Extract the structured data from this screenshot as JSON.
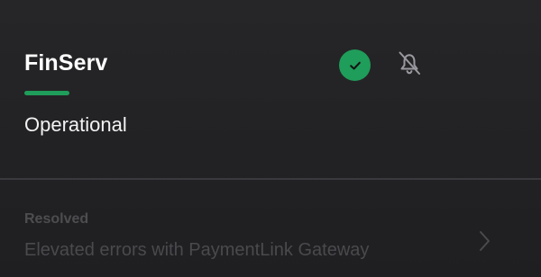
{
  "service": {
    "name": "FinServ",
    "status": "Operational",
    "status_icon": "check-circle-icon",
    "notification_icon": "bell-off-icon",
    "accent_color": "#1f9d5a"
  },
  "incident": {
    "status": "Resolved",
    "title": "Elevated errors with PaymentLink Gateway",
    "action_icon": "chevron-right-icon"
  }
}
